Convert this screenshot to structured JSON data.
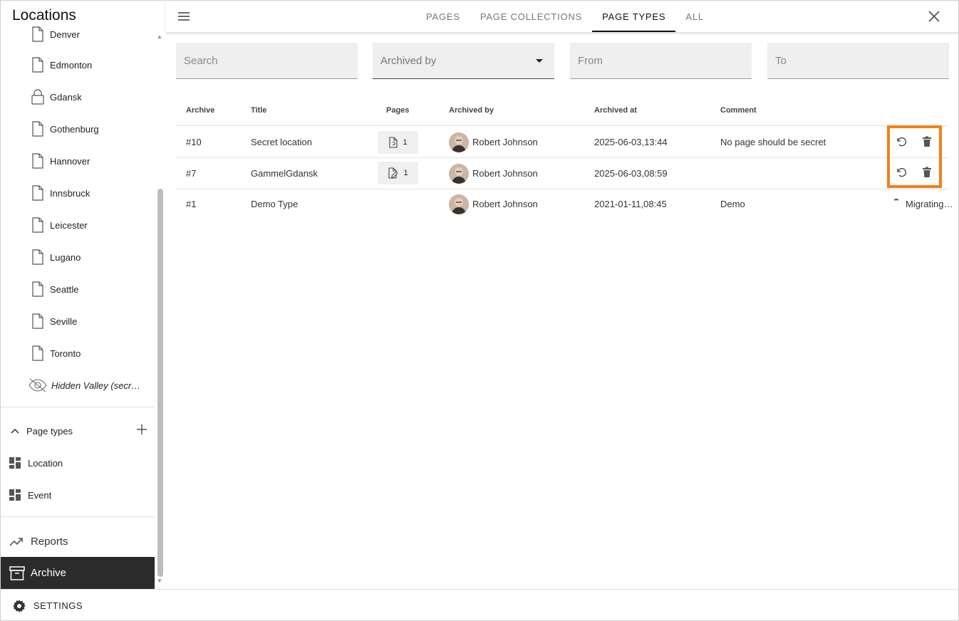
{
  "sidebar": {
    "title": "Locations",
    "tree_items": [
      {
        "label": "Denver",
        "icon": "page-icon"
      },
      {
        "label": "Edmonton",
        "icon": "page-icon"
      },
      {
        "label": "Gdansk",
        "icon": "lock-icon"
      },
      {
        "label": "Gothenburg",
        "icon": "page-icon"
      },
      {
        "label": "Hannover",
        "icon": "page-icon"
      },
      {
        "label": "Innsbruck",
        "icon": "page-icon"
      },
      {
        "label": "Leicester",
        "icon": "page-icon"
      },
      {
        "label": "Lugano",
        "icon": "page-icon"
      },
      {
        "label": "Seattle",
        "icon": "page-icon"
      },
      {
        "label": "Seville",
        "icon": "page-icon"
      },
      {
        "label": "Toronto",
        "icon": "page-icon"
      },
      {
        "label": "Hidden Valley (secr…",
        "icon": "eye-off-icon"
      }
    ],
    "page_types_section": {
      "label": "Page types",
      "items": [
        {
          "label": "Location",
          "icon": "dashboard-icon"
        },
        {
          "label": "Event",
          "icon": "dashboard-icon"
        }
      ]
    },
    "nav": {
      "reports": "Reports",
      "archive": "Archive"
    }
  },
  "settings": {
    "label": "SETTINGS"
  },
  "topbar": {
    "tabs": [
      {
        "label": "PAGES",
        "active": false
      },
      {
        "label": "PAGE COLLECTIONS",
        "active": false
      },
      {
        "label": "PAGE TYPES",
        "active": true
      },
      {
        "label": "ALL",
        "active": false
      }
    ]
  },
  "filters": {
    "search_placeholder": "Search",
    "archived_by_placeholder": "Archived by",
    "from_placeholder": "From",
    "to_placeholder": "To"
  },
  "table": {
    "columns": [
      "Archive",
      "Title",
      "Pages",
      "Archived by",
      "Archived at",
      "Comment"
    ],
    "rows": [
      {
        "archive": "#10",
        "title": "Secret location",
        "pages": "1",
        "pages_icon": "page-sync-icon",
        "archived_by": "Robert Johnson",
        "archived_at": "2025-06-03,13:44",
        "comment": "No page should be secret",
        "actions": true
      },
      {
        "archive": "#7",
        "title": "GammelGdansk",
        "pages": "1",
        "pages_icon": "page-edit-icon",
        "archived_by": "Robert Johnson",
        "archived_at": "2025-06-03,08:59",
        "comment": "",
        "actions": true
      },
      {
        "archive": "#1",
        "title": "Demo Type",
        "pages": "",
        "archived_by": "Robert Johnson",
        "archived_at": "2021-01-11,08:45",
        "comment": "Demo",
        "actions": false,
        "status": "Migrating…"
      }
    ]
  },
  "colors": {
    "highlight": "#f57f17",
    "active_nav_bg": "#2b2b2b",
    "filter_bg": "#efefef"
  }
}
